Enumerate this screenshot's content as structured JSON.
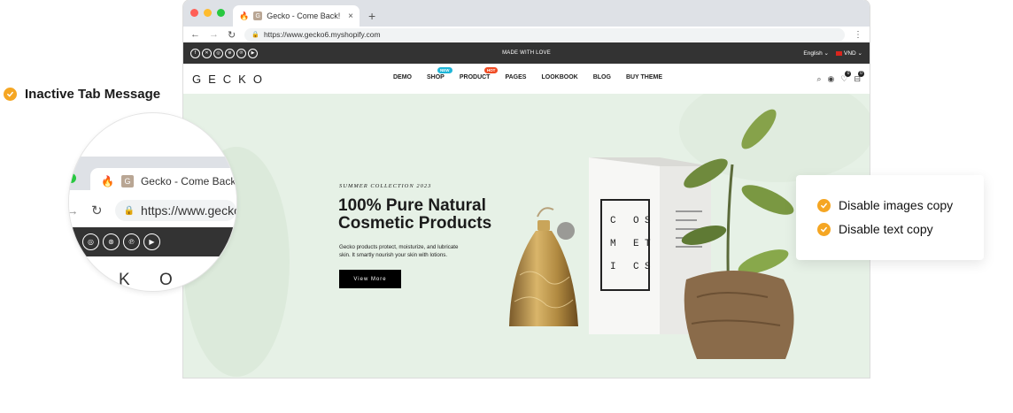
{
  "callouts": {
    "inactive_tab": "Inactive Tab Message",
    "disable_images": "Disable images copy",
    "disable_text": "Disable text copy"
  },
  "browser": {
    "tab_title": "Gecko - Come Back!",
    "tab_favicon_letter": "G",
    "new_tab_label": "+",
    "close_label": "×",
    "url_scheme": "https://",
    "url_host": "www.gecko6.myshopify.com",
    "url_full": "https://www.gecko6.myshopify.com",
    "traffic_lights": [
      "#ff5f57",
      "#febc2e",
      "#28c840"
    ]
  },
  "announcement": {
    "text": "MADE WITH LOVE",
    "language": "English",
    "currency": "VND",
    "social_icons": [
      "facebook-icon",
      "x-icon",
      "instagram-icon",
      "dribbble-icon",
      "pinterest-icon",
      "youtube-icon"
    ]
  },
  "header": {
    "logo": "GECKO",
    "nav": [
      {
        "label": "DEMO"
      },
      {
        "label": "SHOP",
        "badge": "NEW",
        "badge_color": "#1fb6d8"
      },
      {
        "label": "PRODUCT",
        "badge": "HOT",
        "badge_color": "#f04b23"
      },
      {
        "label": "PAGES"
      },
      {
        "label": "LOOKBOOK"
      },
      {
        "label": "BLOG"
      },
      {
        "label": "BUY THEME"
      }
    ],
    "wishlist_count": "0",
    "cart_count": "0"
  },
  "hero": {
    "subtitle": "SUMMER COLLECTION 2023",
    "title_line1": "100% Pure Natural",
    "title_line2": "Cosmetic Products",
    "desc_line1": "Gecko products protect, moisturize, and lubricate",
    "desc_line2": "skin. It smartly nourish your skin with lotions.",
    "button": "View More",
    "box_letters": [
      "C",
      "O",
      "S",
      "M",
      "E",
      "T",
      "I",
      "C",
      "S"
    ]
  },
  "magnifier": {
    "tab_title": "Gecko - Come Back!",
    "url_partial": "https://www.gecko",
    "logo_partial": "K O"
  },
  "colors": {
    "accent_check": "#f5a623",
    "announce_bg": "#333333",
    "hero_bg": "#e6f1e6"
  }
}
